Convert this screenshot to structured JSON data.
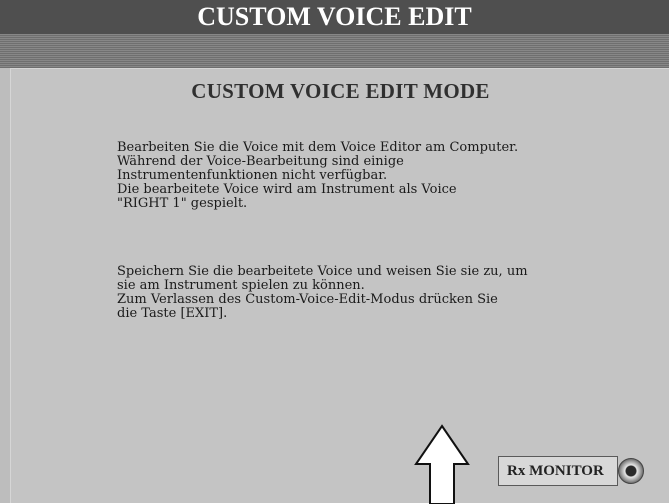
{
  "header": {
    "title": "CUSTOM VOICE EDIT"
  },
  "panel": {
    "mode_title": "CUSTOM VOICE EDIT MODE",
    "paragraph1": "Bearbeiten Sie die Voice mit dem Voice Editor am Computer.\nWährend der Voice-Bearbeitung sind einige\nInstrumentenfunktionen nicht verfügbar.\nDie bearbeitete Voice wird am Instrument als Voice\n\"RIGHT 1\" gespielt.",
    "paragraph2": "Speichern Sie die bearbeitete Voice und weisen Sie sie zu, um\nsie am Instrument spielen zu können.\nZum Verlassen des Custom-Voice-Edit-Modus drücken Sie\ndie Taste [EXIT]."
  },
  "rx_monitor": {
    "label": "Rx MONITOR"
  },
  "icons": {
    "arrow": "up-arrow-icon",
    "indicator": "monitor-lamp-icon"
  },
  "colors": {
    "title_bar": "#4f4f4f",
    "panel_bg": "#c4c4c4",
    "text": "#1a1a1a"
  }
}
